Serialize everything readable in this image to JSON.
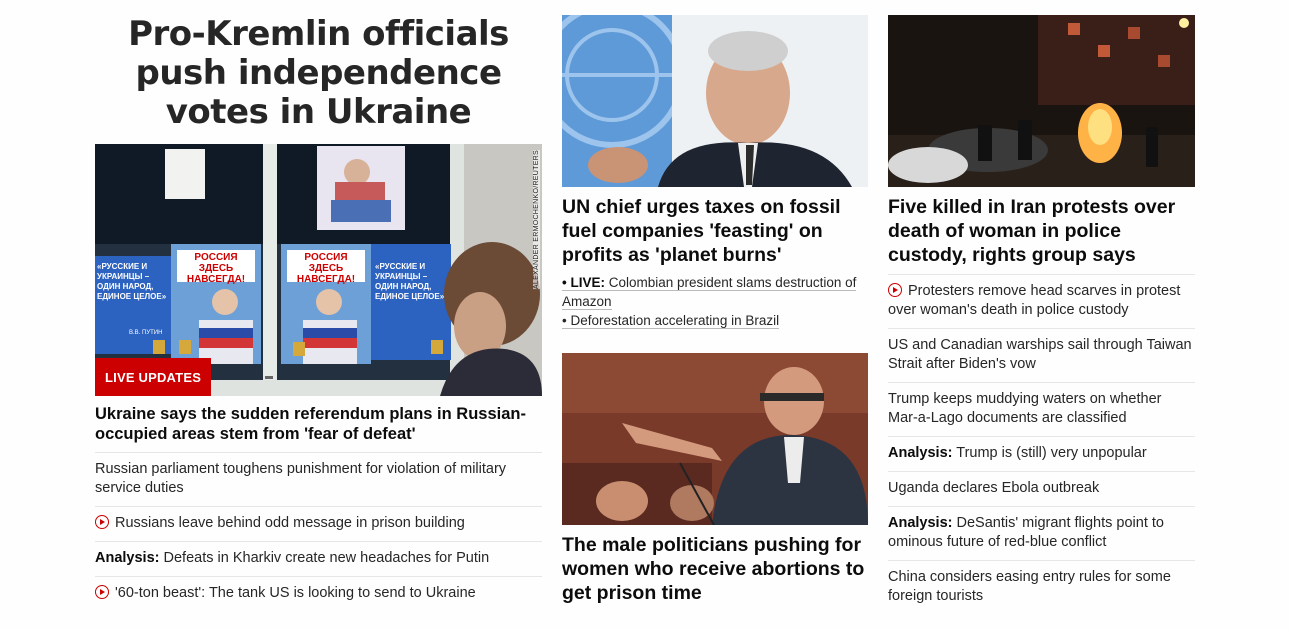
{
  "main_story": {
    "headline": "Pro-Kremlin officials push independence votes in Ukraine",
    "image_credit": "ALEXANDER ERMOCHENKO/REUTERS",
    "poster_texts": {
      "left_slogan": "«РУССКИЕ И УКРАИНЦЫ – ОДИН НАРОД, ЕДИНОЕ ЦЕЛОЕ»",
      "left_signature": "В.В. ПУТИН",
      "center_headline": "РОССИЯ ЗДЕСЬ НАВСЕГДА!"
    },
    "badge": "LIVE UPDATES",
    "lead_title": "Ukraine says the sudden referendum plans in Russian-occupied areas stem from 'fear of defeat'",
    "links": [
      {
        "prefix": "",
        "text": "Russian parliament toughens punishment for violation of military service duties",
        "video": false
      },
      {
        "prefix": "",
        "text": "Russians leave behind odd message in prison building",
        "video": true
      },
      {
        "prefix": "Analysis:",
        "text": " Defeats in Kharkiv create new headaches for Putin",
        "video": false
      },
      {
        "prefix": "",
        "text": "'60-ton beast': The tank US is looking to send to Ukraine",
        "video": true
      }
    ]
  },
  "middle_column": {
    "card1": {
      "title": "UN chief urges taxes on fossil fuel companies 'feasting' on profits as 'planet burns'",
      "sublinks": [
        {
          "prefix": "• LIVE:",
          "text": " Colombian president slams destruction of Amazon"
        },
        {
          "prefix": "•",
          "text": " Deforestation accelerating in Brazil"
        }
      ]
    },
    "card2": {
      "title": "The male politicians pushing for women who receive abortions to get prison time"
    }
  },
  "right_column": {
    "card_title": "Five killed in Iran protests over death of woman in police custody, rights group says",
    "links": [
      {
        "prefix": "",
        "text": "Protesters remove head scarves in protest over woman's death in police custody",
        "video": true
      },
      {
        "prefix": "",
        "text": "US and Canadian warships sail through Taiwan Strait after Biden's vow",
        "video": false
      },
      {
        "prefix": "",
        "text": "Trump keeps muddying waters on whether Mar-a-Lago documents are classified",
        "video": false
      },
      {
        "prefix": "Analysis:",
        "text": " Trump is (still) very unpopular",
        "video": false
      },
      {
        "prefix": "",
        "text": "Uganda declares Ebola outbreak",
        "video": false
      },
      {
        "prefix": "Analysis:",
        "text": " DeSantis' migrant flights point to ominous future of red-blue conflict",
        "video": false
      },
      {
        "prefix": "",
        "text": "China considers easing entry rules for some foreign tourists",
        "video": false
      }
    ]
  },
  "colors": {
    "accent_red": "#cc0000",
    "divider": "#e6e6e6",
    "text": "#0c0c0c"
  }
}
